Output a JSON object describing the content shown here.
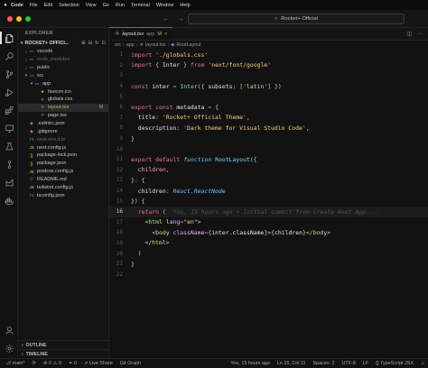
{
  "menubar": {
    "app": "Code",
    "items": [
      "File",
      "Edit",
      "Selection",
      "View",
      "Go",
      "Run",
      "Terminal",
      "Window",
      "Help"
    ]
  },
  "titlebar": {
    "search": "Rocket+ Official"
  },
  "sidebar": {
    "header": "EXPLORER",
    "title": "ROCKET+ OFFICI...",
    "tree": [
      {
        "label": "vscode",
        "depth": 1,
        "kind": "folder",
        "open": false
      },
      {
        "label": "node_modules",
        "depth": 1,
        "kind": "folder",
        "open": false,
        "dim": true
      },
      {
        "label": "public",
        "depth": 1,
        "kind": "folder",
        "open": false
      },
      {
        "label": "src",
        "depth": 1,
        "kind": "folder",
        "open": true
      },
      {
        "label": "app",
        "depth": 2,
        "kind": "folder",
        "open": true
      },
      {
        "label": "favicon.ico",
        "depth": 3,
        "kind": "ico"
      },
      {
        "label": "globals.css",
        "depth": 3,
        "kind": "css"
      },
      {
        "label": "layout.tsx",
        "depth": 3,
        "kind": "tsx",
        "badge": "M",
        "selected": true,
        "modified": true
      },
      {
        "label": "page.tsx",
        "depth": 3,
        "kind": "tsx"
      },
      {
        "label": ".eslintrc.json",
        "depth": 1,
        "kind": "eslint"
      },
      {
        "label": ".gitignore",
        "depth": 1,
        "kind": "git"
      },
      {
        "label": "next-env.d.ts",
        "depth": 1,
        "kind": "ts",
        "dim": true
      },
      {
        "label": "next.config.js",
        "depth": 1,
        "kind": "js"
      },
      {
        "label": "package-lock.json",
        "depth": 1,
        "kind": "json"
      },
      {
        "label": "package.json",
        "depth": 1,
        "kind": "json"
      },
      {
        "label": "postcss.config.js",
        "depth": 1,
        "kind": "js"
      },
      {
        "label": "README.md",
        "depth": 1,
        "kind": "md"
      },
      {
        "label": "tailwind.config.js",
        "depth": 1,
        "kind": "js"
      },
      {
        "label": "tsconfig.json",
        "depth": 1,
        "kind": "ts"
      }
    ],
    "outline": "OUTLINE",
    "timeline": "TIMELINE"
  },
  "editor": {
    "tab": {
      "name": "layout.tsx",
      "path": "app",
      "modified": "M",
      "close": "×"
    },
    "breadcrumb": [
      "src",
      "app",
      "layout.tsx",
      "RootLayout"
    ],
    "current_line": 16,
    "blame": "You, 15 hours ago • Initial commit from Create Next App ...",
    "lines": [
      {
        "n": "1",
        "tokens": [
          [
            "k",
            "import"
          ],
          [
            "v",
            " "
          ],
          [
            "s",
            "'./globals.css'"
          ]
        ]
      },
      {
        "n": "2",
        "tokens": [
          [
            "k",
            "import"
          ],
          [
            "p",
            " { "
          ],
          [
            "v",
            "Inter"
          ],
          [
            "p",
            " } "
          ],
          [
            "k",
            "from"
          ],
          [
            "v",
            " "
          ],
          [
            "s",
            "'next/font/google'"
          ]
        ]
      },
      {
        "n": "3",
        "tokens": []
      },
      {
        "n": "4",
        "tokens": [
          [
            "k",
            "const"
          ],
          [
            "v",
            " inter "
          ],
          [
            "k",
            "="
          ],
          [
            "v",
            " "
          ],
          [
            "fn",
            "Inter"
          ],
          [
            "p",
            "({ "
          ],
          [
            "v",
            "subsets"
          ],
          [
            "p",
            ": ["
          ],
          [
            "s",
            "'latin'"
          ],
          [
            "p",
            "] })"
          ]
        ]
      },
      {
        "n": "5",
        "tokens": []
      },
      {
        "n": "6",
        "tokens": [
          [
            "k",
            "export"
          ],
          [
            "v",
            " "
          ],
          [
            "k",
            "const"
          ],
          [
            "v",
            " metadata "
          ],
          [
            "k",
            "="
          ],
          [
            "p",
            " {"
          ]
        ]
      },
      {
        "n": "7",
        "tokens": [
          [
            "v",
            "  title"
          ],
          [
            "p",
            ": "
          ],
          [
            "s",
            "'Rocket+ Official Theme'"
          ],
          [
            "p",
            ","
          ]
        ]
      },
      {
        "n": "8",
        "tokens": [
          [
            "v",
            "  description"
          ],
          [
            "p",
            ": "
          ],
          [
            "s",
            "'Dark theme for Visual Studio Code'"
          ],
          [
            "p",
            ","
          ]
        ]
      },
      {
        "n": "9",
        "tokens": [
          [
            "p",
            "}"
          ]
        ]
      },
      {
        "n": "10",
        "tokens": []
      },
      {
        "n": "11",
        "tokens": [
          [
            "k",
            "export"
          ],
          [
            "v",
            " "
          ],
          [
            "k",
            "default"
          ],
          [
            "v",
            " "
          ],
          [
            "ty",
            "function"
          ],
          [
            "v",
            " "
          ],
          [
            "fn",
            "RootLayout"
          ],
          [
            "p",
            "({"
          ]
        ]
      },
      {
        "n": "12",
        "tokens": [
          [
            "pr",
            "  children"
          ],
          [
            "p",
            ","
          ]
        ]
      },
      {
        "n": "13",
        "tokens": [
          [
            "p",
            "}"
          ],
          [
            "k",
            ":"
          ],
          [
            "p",
            " {"
          ]
        ]
      },
      {
        "n": "14",
        "tokens": [
          [
            "v",
            "  children"
          ],
          [
            "k",
            ":"
          ],
          [
            "v",
            " "
          ],
          [
            "ty",
            "React.ReactNode"
          ]
        ]
      },
      {
        "n": "15",
        "tokens": [
          [
            "p",
            "}) {"
          ]
        ]
      },
      {
        "n": "16",
        "tokens": [
          [
            "k",
            "  return"
          ],
          [
            "p",
            " ("
          ]
        ]
      },
      {
        "n": "17",
        "tokens": [
          [
            "p",
            "    <"
          ],
          [
            "tg",
            "html"
          ],
          [
            "v",
            " "
          ],
          [
            "at",
            "lang"
          ],
          [
            "k",
            "="
          ],
          [
            "s",
            "\"en\""
          ],
          [
            "p",
            ">"
          ]
        ]
      },
      {
        "n": "18",
        "tokens": [
          [
            "p",
            "      <"
          ],
          [
            "tg",
            "body"
          ],
          [
            "v",
            " "
          ],
          [
            "at",
            "className"
          ],
          [
            "k",
            "="
          ],
          [
            "p",
            "{"
          ],
          [
            "v",
            "inter.className"
          ],
          [
            "p",
            "}>{"
          ],
          [
            "v",
            "children"
          ],
          [
            "p",
            "}</"
          ],
          [
            "tg",
            "body"
          ],
          [
            "p",
            ">"
          ]
        ]
      },
      {
        "n": "19",
        "tokens": [
          [
            "p",
            "    </"
          ],
          [
            "tg",
            "html"
          ],
          [
            "p",
            ">"
          ]
        ]
      },
      {
        "n": "20",
        "tokens": [
          [
            "p",
            "  )"
          ]
        ]
      },
      {
        "n": "21",
        "tokens": [
          [
            "p",
            "}"
          ]
        ]
      },
      {
        "n": "22",
        "tokens": []
      }
    ]
  },
  "statusbar": {
    "branch": "main*",
    "sync": "⟳",
    "problems": "⊗ 0 ⚠ 0",
    "ports": "⚭ 0",
    "live_share": "Live Share",
    "graph": "Git Graph",
    "blame": "You, 15 hours ago",
    "position": "Ln 16, Col 11",
    "spaces": "Spaces: 2",
    "encoding": "UTF-8",
    "eol": "LF",
    "language": "{} TypeScript JSX"
  },
  "colors": {
    "keyword": "#f0719b",
    "string": "#f6d37a",
    "function": "#7fd8ff",
    "tag": "#a5e88c",
    "attribute": "#dcb3ff",
    "modified": "#d6b35a",
    "background": "#121212"
  }
}
